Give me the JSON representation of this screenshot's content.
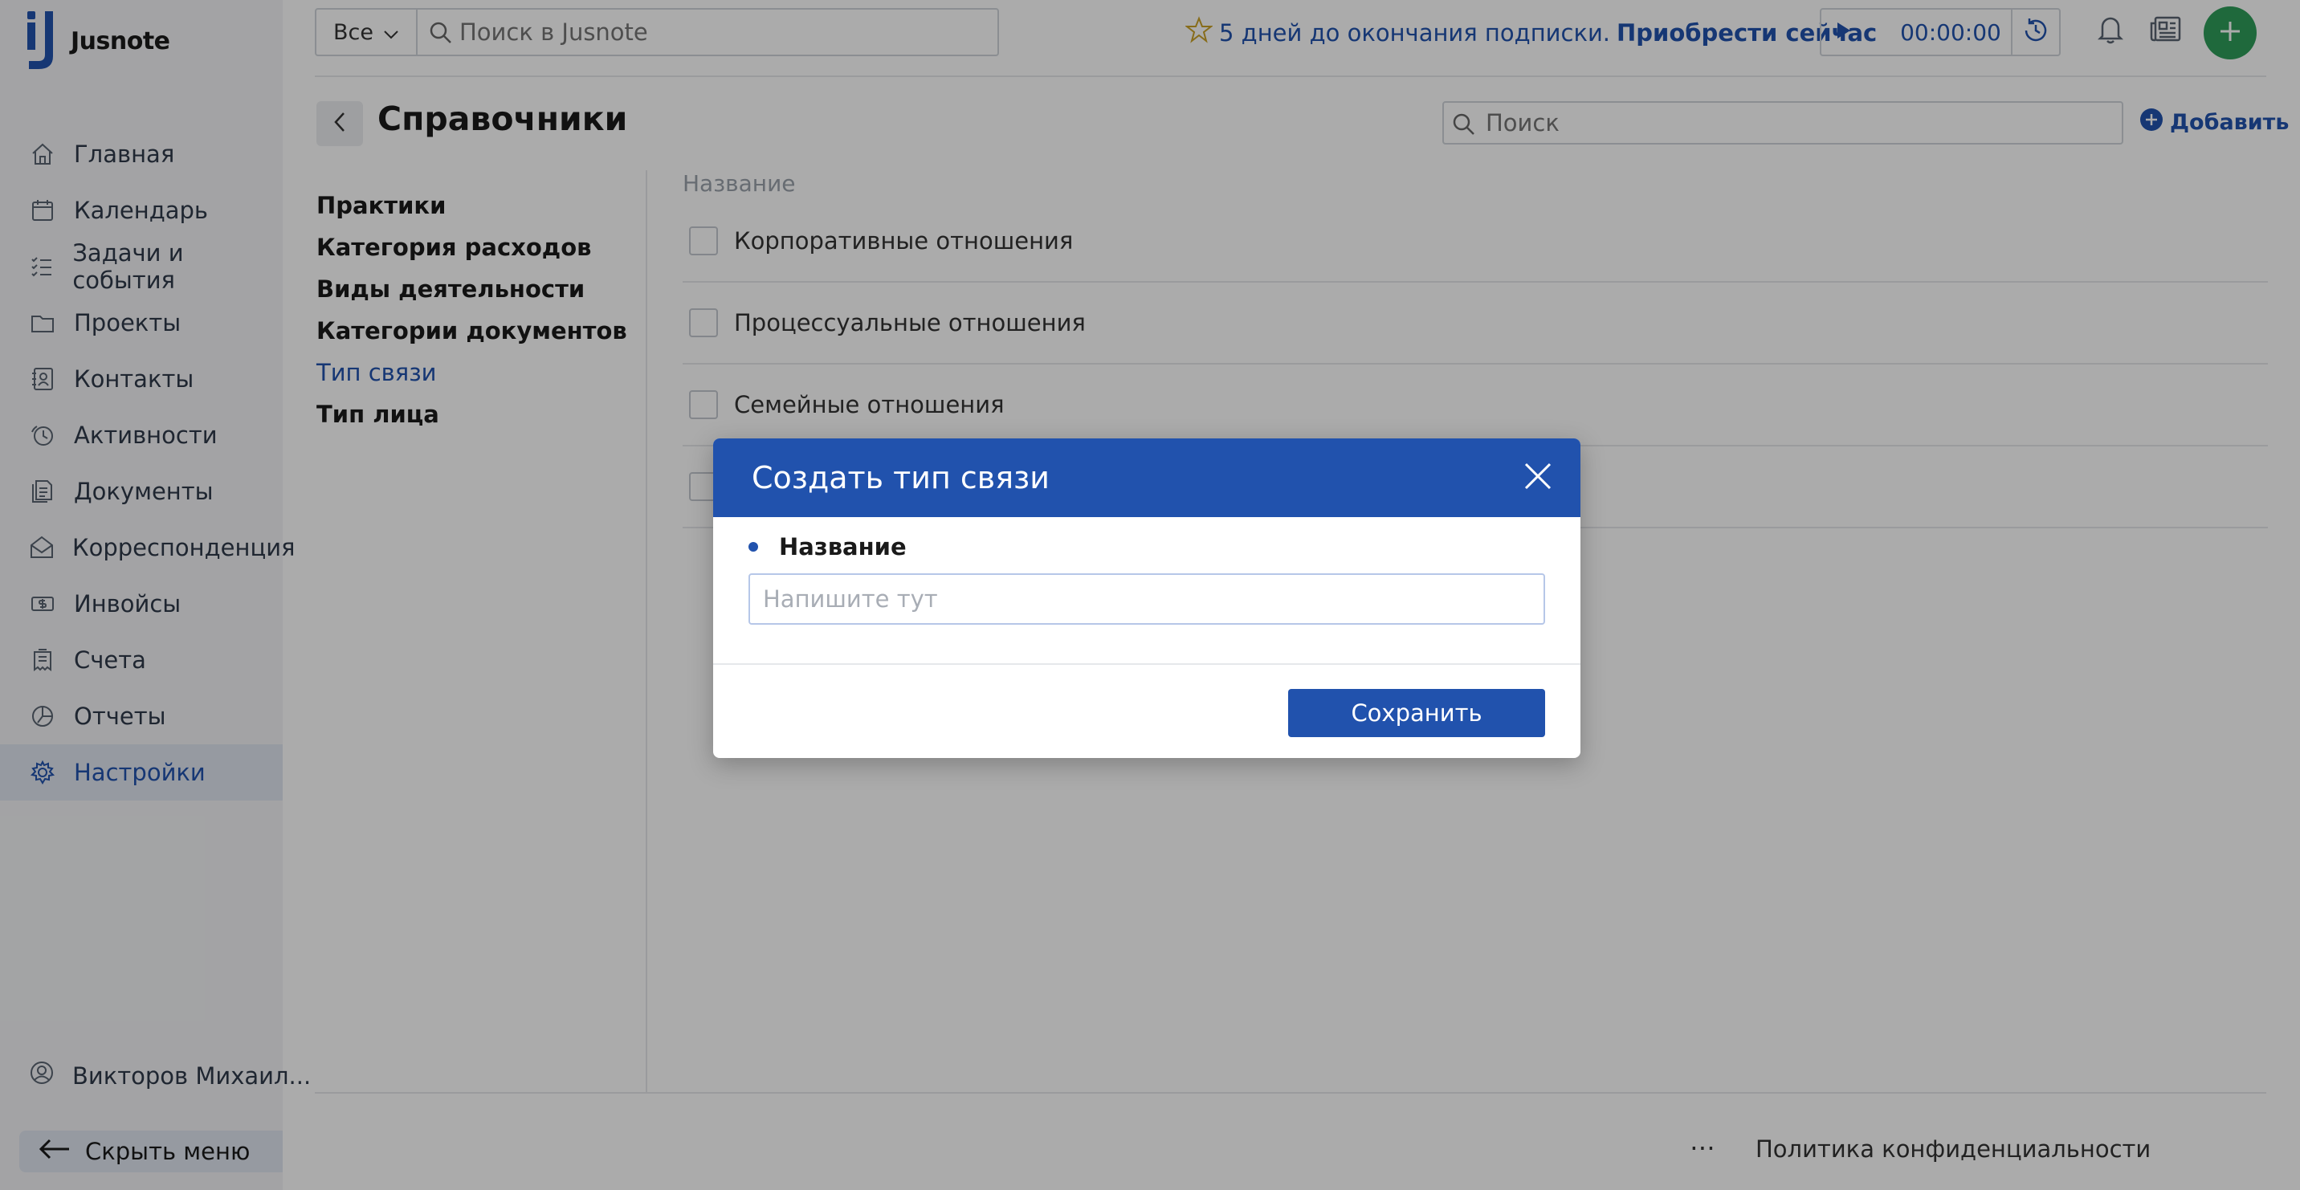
{
  "app": {
    "name": "Jusnote"
  },
  "sidebar": {
    "items": [
      {
        "label": "Главная",
        "icon": "home-icon"
      },
      {
        "label": "Календарь",
        "icon": "calendar-icon"
      },
      {
        "label": "Задачи и события",
        "icon": "tasks-icon"
      },
      {
        "label": "Проекты",
        "icon": "folder-icon"
      },
      {
        "label": "Контакты",
        "icon": "contacts-icon"
      },
      {
        "label": "Активности",
        "icon": "activity-icon"
      },
      {
        "label": "Документы",
        "icon": "documents-icon"
      },
      {
        "label": "Корреспонденция",
        "icon": "mail-icon"
      },
      {
        "label": "Инвойсы",
        "icon": "invoice-icon"
      },
      {
        "label": "Счета",
        "icon": "bill-icon"
      },
      {
        "label": "Отчеты",
        "icon": "reports-icon"
      },
      {
        "label": "Настройки",
        "icon": "gear-icon",
        "active": true
      }
    ],
    "user": "Викторов Михаил...",
    "hide_menu": "Скрыть меню"
  },
  "topbar": {
    "scope": "Все",
    "search_placeholder": "Поиск в Jusnote",
    "promo_text": "5 дней до окончания подписки.",
    "promo_link": "Приобрести сейчас",
    "timer": "00:00:00"
  },
  "main": {
    "title": "Справочники",
    "search_placeholder": "Поиск",
    "add_label": "Добавить",
    "dictionaries": [
      {
        "label": "Практики"
      },
      {
        "label": "Категория расходов"
      },
      {
        "label": "Виды деятельности"
      },
      {
        "label": "Категории документов"
      },
      {
        "label": "Тип связи",
        "active": true
      },
      {
        "label": "Тип лица"
      }
    ],
    "column_header": "Название",
    "rows": [
      "Корпоративные отношения",
      "Процессуальные отношения",
      "Семейные отношения",
      ""
    ]
  },
  "footer": {
    "privacy": "Политика конфиденциальности"
  },
  "modal": {
    "title": "Создать тип связи",
    "field_label": "Название",
    "field_placeholder": "Напишите тут",
    "field_value": "",
    "save_label": "Сохранить"
  },
  "colors": {
    "accent": "#2152ad",
    "add_button": "#2f9d5a",
    "overlay": "rgba(0,0,0,0.33)"
  }
}
